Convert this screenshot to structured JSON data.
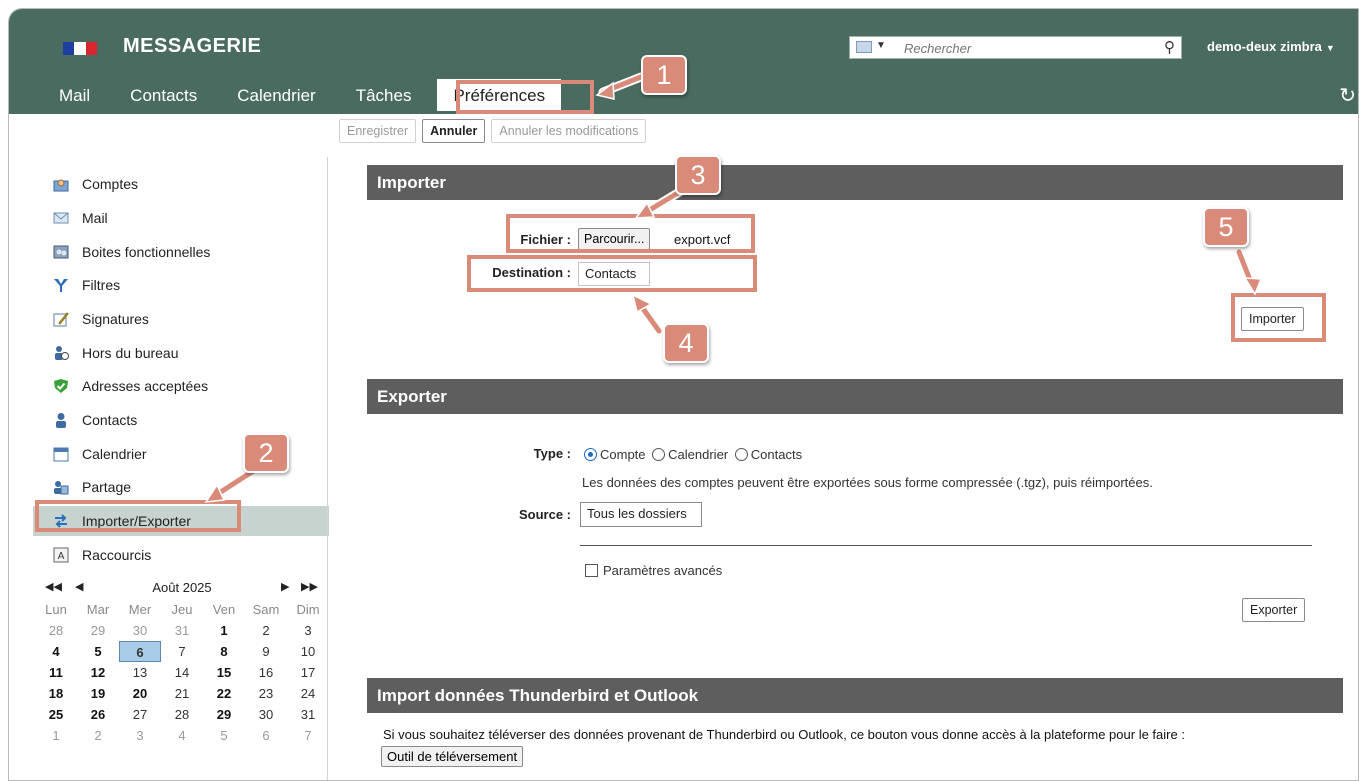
{
  "app": {
    "title": "MESSAGERIE",
    "user": "demo-deux zimbra",
    "search_placeholder": "Rechercher",
    "flag_colors": [
      "#1f3fa0",
      "#ffffff",
      "#d8262f"
    ]
  },
  "tabs": [
    {
      "label": "Mail"
    },
    {
      "label": "Contacts"
    },
    {
      "label": "Calendrier"
    },
    {
      "label": "Tâches"
    },
    {
      "label": "Préférences",
      "active": true
    }
  ],
  "toolbar": {
    "save": "Enregistrer",
    "cancel": "Annuler",
    "undo_changes": "Annuler les modifications"
  },
  "sidebar": {
    "items": [
      {
        "label": "Comptes",
        "icon": "accounts-icon"
      },
      {
        "label": "Mail",
        "icon": "mail-icon"
      },
      {
        "label": "Boites fonctionnelles",
        "icon": "shared-mailboxes-icon"
      },
      {
        "label": "Filtres",
        "icon": "filter-icon"
      },
      {
        "label": "Signatures",
        "icon": "signature-icon"
      },
      {
        "label": "Hors du bureau",
        "icon": "out-of-office-icon"
      },
      {
        "label": "Adresses acceptées",
        "icon": "shield-check-icon"
      },
      {
        "label": "Contacts",
        "icon": "contact-icon"
      },
      {
        "label": "Calendrier",
        "icon": "calendar-icon"
      },
      {
        "label": "Partage",
        "icon": "sharing-icon"
      },
      {
        "label": "Importer/Exporter",
        "icon": "import-export-icon",
        "active": true
      },
      {
        "label": "Raccourcis",
        "icon": "shortcuts-icon"
      }
    ]
  },
  "calendar": {
    "month": "Août 2025",
    "nav": {
      "prev_year": "◀◀",
      "prev_month": "◀",
      "next_month": "▶",
      "next_year": "▶▶"
    },
    "weekdays": [
      "Lun",
      "Mar",
      "Mer",
      "Jeu",
      "Ven",
      "Sam",
      "Dim"
    ],
    "weeks": [
      [
        "28",
        "29",
        "30",
        "31",
        "1",
        "2",
        "3"
      ],
      [
        "4",
        "5",
        "6",
        "7",
        "8",
        "9",
        "10"
      ],
      [
        "11",
        "12",
        "13",
        "14",
        "15",
        "16",
        "17"
      ],
      [
        "18",
        "19",
        "20",
        "21",
        "22",
        "23",
        "24"
      ],
      [
        "25",
        "26",
        "27",
        "28",
        "29",
        "30",
        "31"
      ],
      [
        "1",
        "2",
        "3",
        "4",
        "5",
        "6",
        "7"
      ]
    ],
    "today": "6"
  },
  "importer": {
    "title": "Importer",
    "file_label": "Fichier :",
    "browse": "Parcourir...",
    "file_name": "export.vcf",
    "destination_label": "Destination :",
    "destination_value": "Contacts",
    "button": "Importer"
  },
  "exporter": {
    "title": "Exporter",
    "type_label": "Type :",
    "options": [
      {
        "label": "Compte",
        "selected": true
      },
      {
        "label": "Calendrier",
        "selected": false
      },
      {
        "label": "Contacts",
        "selected": false
      }
    ],
    "hint": "Les données des comptes peuvent être exportées sous forme compressée (.tgz), puis réimportées.",
    "source_label": "Source :",
    "source_value": "Tous les dossiers",
    "advanced": "Paramètres avancés",
    "button": "Exporter"
  },
  "thunderbird": {
    "title": "Import données Thunderbird et Outlook",
    "text": "Si vous souhaitez téléverser des données provenant de Thunderbird ou Outlook, ce bouton vous donne accès à la plateforme pour le faire :",
    "button": "Outil de téléversement"
  },
  "annotations": {
    "color": "#d98a78",
    "badges": [
      "1",
      "2",
      "3",
      "4",
      "5"
    ]
  }
}
